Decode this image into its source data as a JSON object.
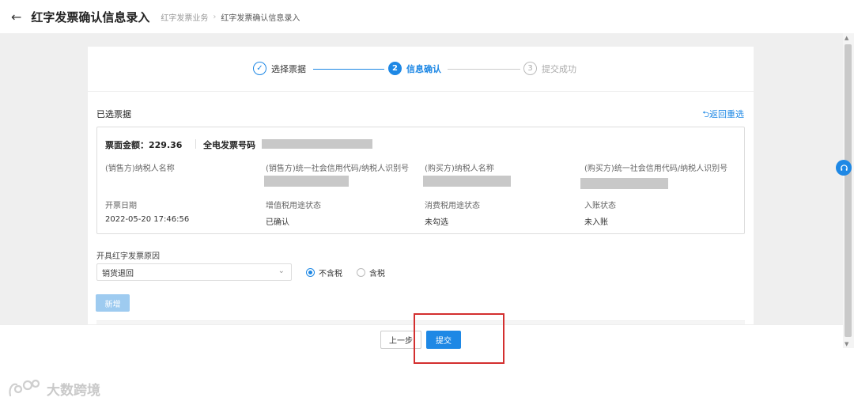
{
  "header": {
    "back_icon": "arrow-left-icon",
    "title": "红字发票确认信息录入",
    "breadcrumb": [
      "红字发票业务",
      "红字发票确认信息录入"
    ],
    "separator": "›"
  },
  "steps": [
    {
      "number": "✓",
      "label": "选择票据",
      "state": "done"
    },
    {
      "number": "2",
      "label": "信息确认",
      "state": "active"
    },
    {
      "number": "3",
      "label": "提交成功",
      "state": "pending"
    }
  ],
  "selected": {
    "title": "已选票据",
    "return_link": "⮌返回重选"
  },
  "invoice": {
    "amount_label": "票面金额：229.36",
    "invoice_no_label": "全电发票号码",
    "fields": [
      {
        "label": "(销售方)纳税人名称",
        "value": ""
      },
      {
        "label": "(销售方)统一社会信用代码/纳税人识别号",
        "value": ""
      },
      {
        "label": "(购买方)纳税人名称",
        "value": ""
      },
      {
        "label": "(购买方)统一社会信用代码/纳税人识别号",
        "value": ""
      },
      {
        "label": "开票日期",
        "value": "2022-05-20 17:46:56"
      },
      {
        "label": "增值税用途状态",
        "value": "已确认"
      },
      {
        "label": "消费税用途状态",
        "value": "未勾选"
      },
      {
        "label": "入账状态",
        "value": "未入账"
      }
    ]
  },
  "reason": {
    "label": "开具红字发票原因",
    "selected": "销货退回",
    "options_radio": [
      {
        "label": "不含税",
        "checked": true
      },
      {
        "label": "含税",
        "checked": false
      }
    ]
  },
  "actions": {
    "add_label": "新增",
    "prev_label": "上一步",
    "submit_label": "提交"
  },
  "side_badge_icon": "headset-icon",
  "watermark_text": "大数跨境",
  "colors": {
    "accent": "#1e88e5",
    "highlight": "#d32f2f"
  }
}
